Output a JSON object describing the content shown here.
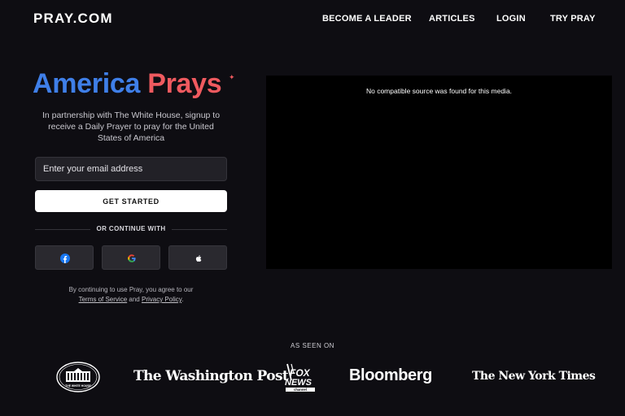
{
  "header": {
    "logo": "PRAY.COM",
    "nav": [
      "BECOME A LEADER",
      "ARTICLES",
      "LOGIN",
      "TRY PRAY"
    ]
  },
  "hero": {
    "title_part1": "America",
    "title_part2": "Prays",
    "subtitle": "In partnership with The White House, signup to receive a Daily Prayer to pray for the United States of America"
  },
  "signup": {
    "email_placeholder": "Enter your email address",
    "cta_label": "GET STARTED",
    "divider_text": "OR CONTINUE WITH",
    "social_buttons": [
      "facebook-icon",
      "google-icon",
      "apple-icon"
    ],
    "terms_prefix": "By continuing to use Pray, you agree to our",
    "terms_link": "Terms of Service",
    "terms_and": "and",
    "privacy_link": "Privacy Policy",
    "terms_suffix": "."
  },
  "video": {
    "message": "No compatible source was found for this media."
  },
  "press": {
    "label": "AS SEEN ON",
    "logos": [
      {
        "name": "white-house-logo",
        "text": "THE WHITE HOUSE"
      },
      {
        "name": "washington-post-logo",
        "text": "The Washington Post"
      },
      {
        "name": "fox-news-logo",
        "text": "FOX NEWS channel"
      },
      {
        "name": "bloomberg-logo",
        "text": "Bloomberg"
      },
      {
        "name": "nyt-logo",
        "text": "The New York Times"
      }
    ]
  },
  "colors": {
    "background": "#0e0d12",
    "brand_blue": "#3f7fe8",
    "brand_red": "#ef5a5f",
    "facebook_blue": "#1877f2"
  }
}
